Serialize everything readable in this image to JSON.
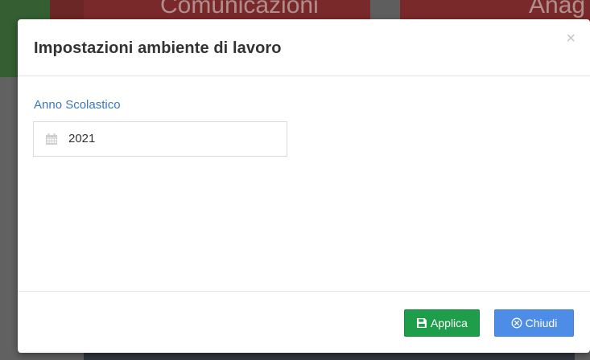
{
  "background": {
    "tiles": [
      {
        "title": "Comunicazioni"
      },
      {
        "title": "Anag"
      }
    ]
  },
  "modal": {
    "title": "Impostazioni ambiente di lavoro",
    "close_symbol": "×",
    "field": {
      "label": "Anno Scolastico",
      "value": "2021",
      "icon": "calendar-icon"
    },
    "footer": {
      "apply_label": "Applica",
      "apply_icon": "save-icon",
      "close_label": "Chiudi",
      "close_icon": "close-circle-icon"
    }
  },
  "colors": {
    "label_blue": "#3a76c4",
    "apply_green": "#1e9e4a",
    "close_blue": "#4d8de8",
    "background_red": "#8a2f2f",
    "background_green": "#3d6b3a"
  }
}
